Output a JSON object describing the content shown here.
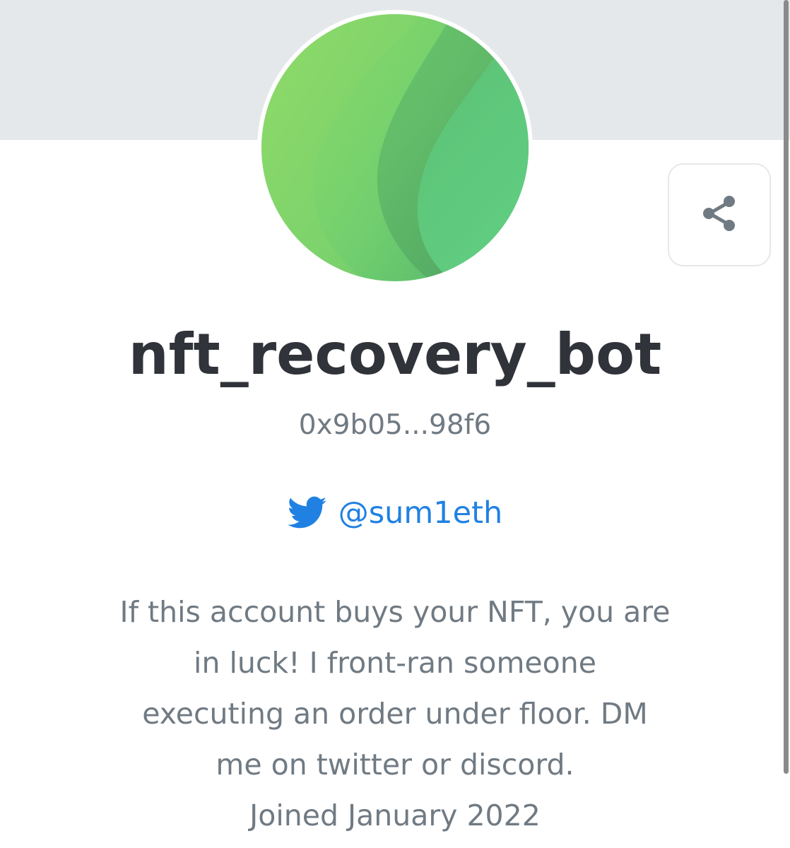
{
  "profile": {
    "username": "nft_recovery_bot",
    "address": "0x9b05...98f6",
    "twitter_handle": "@sum1eth",
    "bio_lines": [
      "If this account buys your NFT, you are",
      "in luck! I front-ran someone",
      "executing an order under floor. DM",
      "me on twitter or discord."
    ],
    "joined": "Joined January 2022"
  },
  "icons": {
    "share": "share-icon",
    "twitter": "twitter-bird-icon"
  },
  "colors": {
    "banner": "#e5e8eb",
    "title": "#303339",
    "muted_text": "#707a83",
    "link": "#2081e2",
    "avatar_gradient": [
      "#8ede6a",
      "#4fa866"
    ]
  }
}
